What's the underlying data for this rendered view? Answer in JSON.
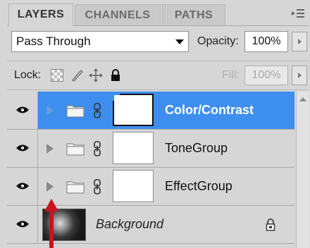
{
  "tabs": [
    {
      "label": "LAYERS",
      "active": true
    },
    {
      "label": "CHANNELS",
      "active": false
    },
    {
      "label": "PATHS",
      "active": false
    }
  ],
  "panel_menu_icon": "panel-menu-icon",
  "blend_mode": {
    "value": "Pass Through"
  },
  "opacity": {
    "label": "Opacity:",
    "value": "100%"
  },
  "lock": {
    "label": "Lock:",
    "icons": [
      "lock-transparent-pixels-icon",
      "lock-image-pixels-icon",
      "lock-position-icon",
      "lock-all-icon"
    ]
  },
  "fill": {
    "label": "Fill:",
    "value": "100%",
    "enabled": false
  },
  "layers": [
    {
      "name": "Color/Contrast",
      "type": "group",
      "selected": true,
      "visible": true
    },
    {
      "name": "ToneGroup",
      "type": "group",
      "selected": false,
      "visible": true
    },
    {
      "name": "EffectGroup",
      "type": "group",
      "selected": false,
      "visible": true
    },
    {
      "name": "Background",
      "type": "background",
      "selected": false,
      "visible": true,
      "locked": true
    }
  ],
  "colors": {
    "selection": "#3d8eef",
    "panel_bg": "#d6d6d6",
    "annotation_arrow": "#c8141e"
  }
}
